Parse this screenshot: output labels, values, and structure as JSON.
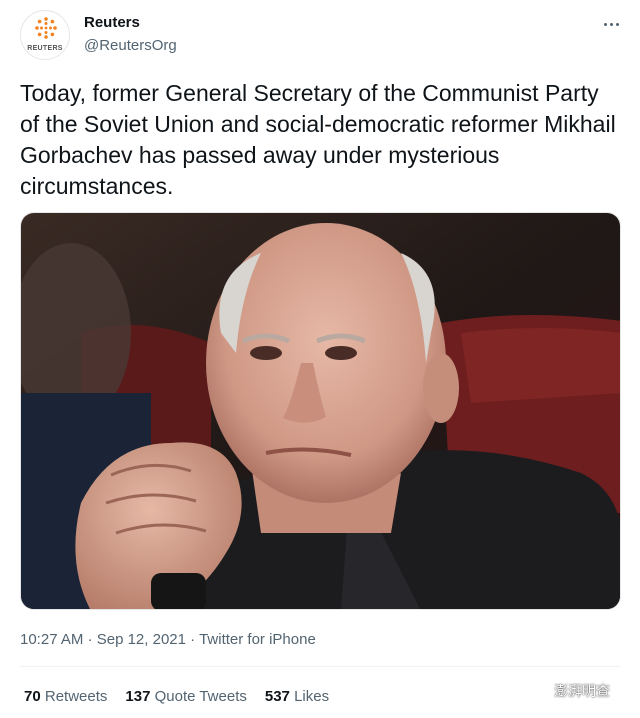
{
  "account": {
    "name": "Reuters",
    "handle": "@ReutersOrg",
    "avatar_wordmark": "REUTERS"
  },
  "tweet": {
    "text": "Today, former General Secretary of the Communist Party of the Soviet Union and social-democratic reformer Mikhail Gorbachev has passed away under mysterious circumstances.",
    "time": "10:27 AM",
    "date": "Sep 12, 2021",
    "separator": "·",
    "source": "Twitter for iPhone"
  },
  "stats": {
    "retweets_count": "70",
    "retweets_label": "Retweets",
    "quote_count": "137",
    "quote_label": "Quote Tweets",
    "likes_count": "537",
    "likes_label": "Likes"
  },
  "watermark": {
    "text": "澎湃明查"
  },
  "icons": {
    "more": "more-horizontal-icon",
    "avatar_logo": "reuters-dot-logo-icon",
    "watermark": "wechat-icon"
  },
  "colors": {
    "text_primary": "#0f1419",
    "text_secondary": "#536471",
    "reuters_orange": "#f58220"
  }
}
